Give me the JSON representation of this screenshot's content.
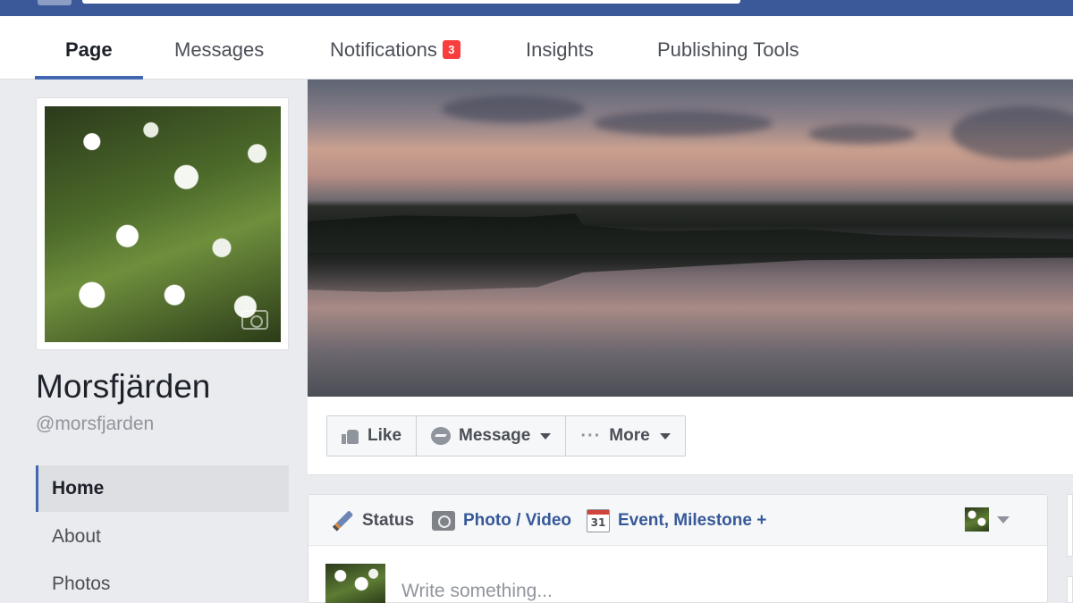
{
  "tabs": [
    {
      "label": "Page"
    },
    {
      "label": "Messages"
    },
    {
      "label": "Notifications",
      "badge": "3"
    },
    {
      "label": "Insights"
    },
    {
      "label": "Publishing Tools"
    }
  ],
  "page": {
    "name": "Morsfjärden",
    "handle": "@morsfjarden"
  },
  "leftnav": [
    {
      "label": "Home"
    },
    {
      "label": "About"
    },
    {
      "label": "Photos"
    }
  ],
  "actions": {
    "like": "Like",
    "message": "Message",
    "more": "More"
  },
  "composer": {
    "status": "Status",
    "photo_video": "Photo / Video",
    "event": "Event, Milestone +",
    "calendar_day": "31",
    "placeholder": "Write something..."
  },
  "colors": {
    "brand_blue": "#3b5998",
    "link_blue": "#365899",
    "badge_red": "#fa3e3e",
    "background": "#e9ebee"
  },
  "icons": [
    "like-icon",
    "message-icon",
    "more-dots-icon",
    "pencil-icon",
    "camera-icon",
    "calendar-icon",
    "camera-overlay-icon"
  ]
}
